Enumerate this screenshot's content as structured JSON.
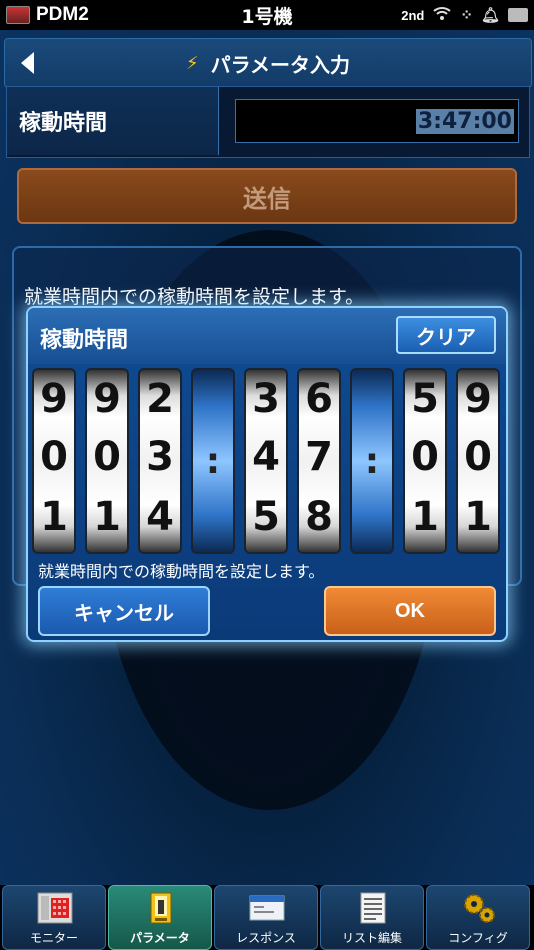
{
  "status_bar": {
    "app_name": "PDM2",
    "title": "1号機",
    "indicator": "2nd"
  },
  "header": {
    "title": "パラメータ入力"
  },
  "parameter": {
    "label": "稼動時間",
    "value": "3:47:00"
  },
  "send_label": "送信",
  "description": "就業時間内での稼動時間を設定します。",
  "dialog": {
    "title": "稼動時間",
    "clear_label": "クリア",
    "drums": [
      {
        "above": "9",
        "current": "0",
        "below": "1"
      },
      {
        "above": "9",
        "current": "0",
        "below": "1"
      },
      {
        "above": "2",
        "current": "3",
        "below": "4"
      },
      {
        "separator": ":"
      },
      {
        "above": "3",
        "current": "4",
        "below": "5"
      },
      {
        "above": "6",
        "current": "7",
        "below": "8"
      },
      {
        "separator": ":"
      },
      {
        "above": "5",
        "current": "0",
        "below": "1"
      },
      {
        "above": "9",
        "current": "0",
        "below": "1"
      }
    ],
    "description": "就業時間内での稼動時間を設定します。",
    "cancel_label": "キャンセル",
    "ok_label": "OK"
  },
  "nav": [
    {
      "label": "モニター",
      "icon": "monitor-icon",
      "active": false
    },
    {
      "label": "パラメータ",
      "icon": "parameter-icon",
      "active": true
    },
    {
      "label": "レスポンス",
      "icon": "response-window-icon",
      "active": false
    },
    {
      "label": "リスト編集",
      "icon": "list-document-icon",
      "active": false
    },
    {
      "label": "コンフィグ",
      "icon": "gears-icon",
      "active": false
    }
  ],
  "colors": {
    "accent_orange": "#e0782a",
    "accent_blue": "#1b5fb2",
    "active_tab": "#2a8a78"
  }
}
